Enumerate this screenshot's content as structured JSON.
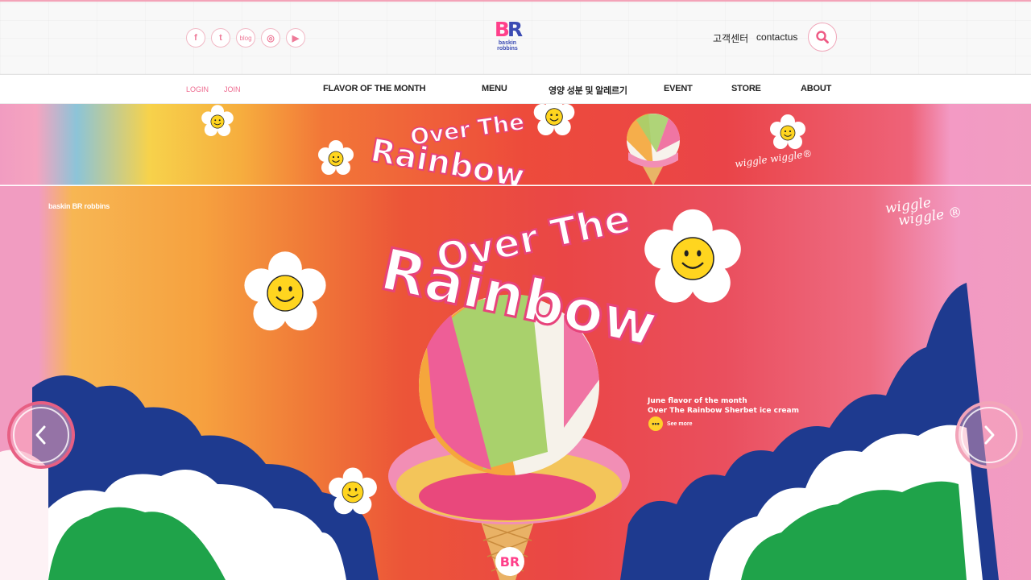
{
  "header": {
    "social": [
      {
        "label": "f",
        "icon": "facebook-icon"
      },
      {
        "label": "t",
        "icon": "twitter-icon"
      },
      {
        "label": "blog",
        "icon": "blog-icon"
      },
      {
        "label": "◎",
        "icon": "instagram-icon"
      },
      {
        "label": "▶",
        "icon": "youtube-icon"
      }
    ],
    "logo": {
      "b": "B",
      "r": "R",
      "word1": "baskin",
      "word2": "robbins"
    },
    "customer_center": "고객센터",
    "contactus": "contactus"
  },
  "nav": {
    "login": "LOGIN",
    "join": "JOIN",
    "items": [
      "FLAVOR OF THE MONTH",
      "MENU",
      "영양 성분 및 알레르기",
      "EVENT",
      "STORE",
      "ABOUT"
    ]
  },
  "banner": {
    "title_line1": "Over The",
    "title_line2": "Rainbow",
    "wiggle": "wiggle wiggle®"
  },
  "hero": {
    "brand": "baskin BR robbins",
    "title_line1": "Over The",
    "title_line2": "Rainbow",
    "wiggle_line1": "wiggle",
    "wiggle_line2": "wiggle ®",
    "caption_line1": "June flavor of the month",
    "caption_line2": "Over The Rainbow Sherbet ice cream",
    "see_more": "See more",
    "see_more_dots": "•••",
    "cone_logo": "BR"
  },
  "colors": {
    "brand_pink": "#ff3f8a",
    "brand_blue": "#3b4bb3",
    "cloud_navy": "#1e3a8f",
    "cloud_green": "#1fa34a"
  }
}
